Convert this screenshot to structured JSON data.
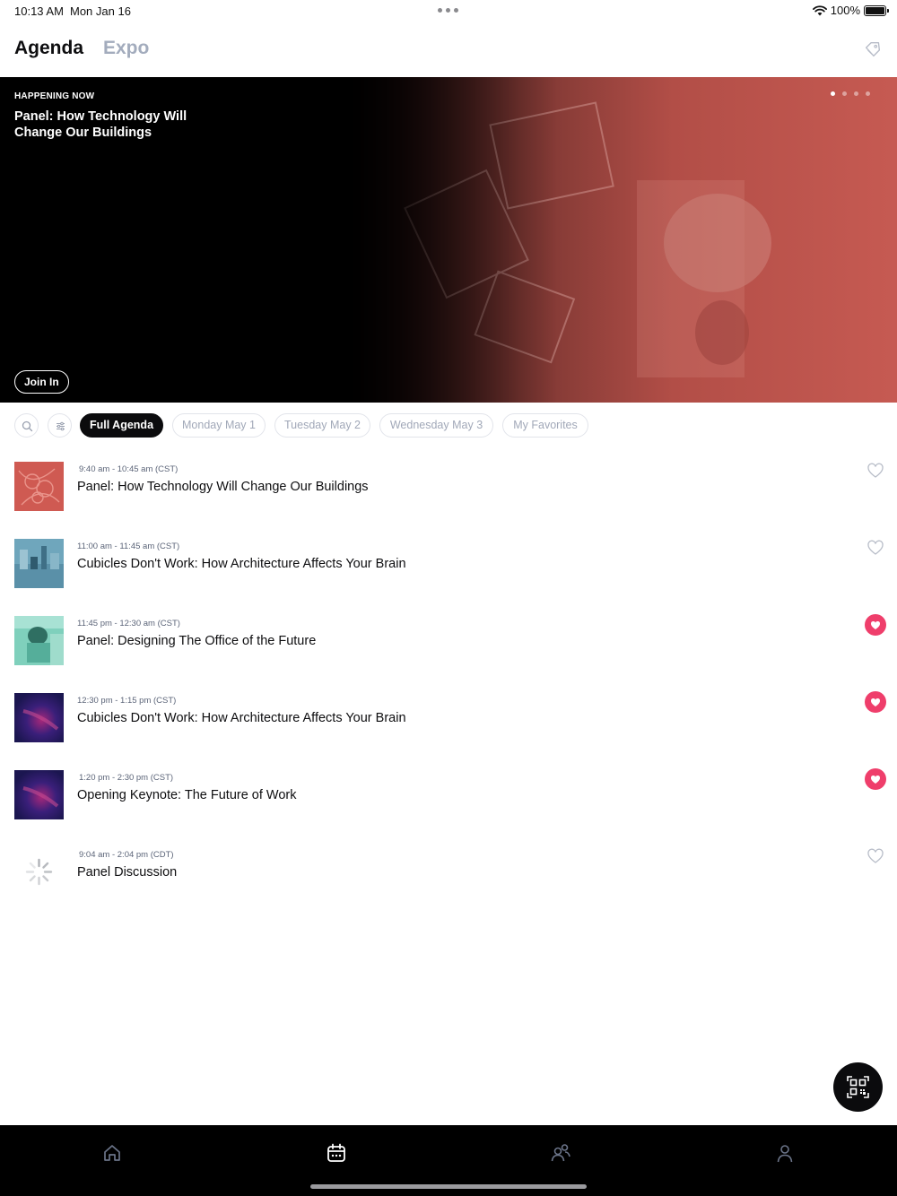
{
  "status_bar": {
    "time": "10:13 AM",
    "date": "Mon Jan 16",
    "battery": "100%",
    "icons": [
      "wifi-icon",
      "battery-icon"
    ]
  },
  "header": {
    "tabs": [
      {
        "label": "Agenda",
        "active": true
      },
      {
        "label": "Expo",
        "active": false
      }
    ],
    "right_icon": "tag-icon"
  },
  "hero": {
    "label": "HAPPENING NOW",
    "title": "Panel: How Technology Will Change Our Buildings",
    "button_label": "Join In",
    "pager_count": 4,
    "pager_active": 0
  },
  "filters": {
    "icons": [
      "search-icon",
      "filter-icon"
    ],
    "chips": [
      {
        "label": "Full Agenda",
        "active": true
      },
      {
        "label": "Monday May 1",
        "active": false
      },
      {
        "label": "Tuesday May 2",
        "active": false
      },
      {
        "label": "Wednesday May 3",
        "active": false
      },
      {
        "label": "My Favorites",
        "active": false
      }
    ]
  },
  "sessions": [
    {
      "time": "9:40 am - 10:45 am (CST)",
      "title": "Panel: How Technology Will Change Our Buildings",
      "favorite": false,
      "thumb": "red-pattern"
    },
    {
      "time": "11:00 am - 11:45 am (CST)",
      "title": "Cubicles Don't Work: How Architecture Affects Your Brain",
      "favorite": false,
      "thumb": "blue-office"
    },
    {
      "time": "11:45 pm - 12:30 am (CST)",
      "title": "Panel: Designing The Office of the Future",
      "favorite": true,
      "thumb": "teal-office"
    },
    {
      "time": "12:30 pm - 1:15 pm (CST)",
      "title": "Cubicles Don't Work: How Architecture Affects Your Brain",
      "favorite": true,
      "thumb": "purple-abstract"
    },
    {
      "time": "1:20 pm - 2:30 pm (CST)",
      "title": "Opening Keynote: The Future of Work",
      "favorite": true,
      "thumb": "purple-abstract"
    },
    {
      "time": "9:04 am - 2:04 pm (CDT)",
      "title": "Panel Discussion",
      "favorite": false,
      "thumb": "loading"
    }
  ],
  "fab": {
    "icon": "qr-code-icon"
  },
  "bottom_nav": {
    "items": [
      {
        "icon": "home-icon",
        "active": false
      },
      {
        "icon": "calendar-icon",
        "active": true
      },
      {
        "icon": "people-icon",
        "active": false
      },
      {
        "icon": "profile-icon",
        "active": false
      }
    ]
  },
  "colors": {
    "accent": "#ef3e6b",
    "hero_red": "#c65a52",
    "muted_text": "#a1a8b8",
    "dark": "#0b0b0d"
  }
}
